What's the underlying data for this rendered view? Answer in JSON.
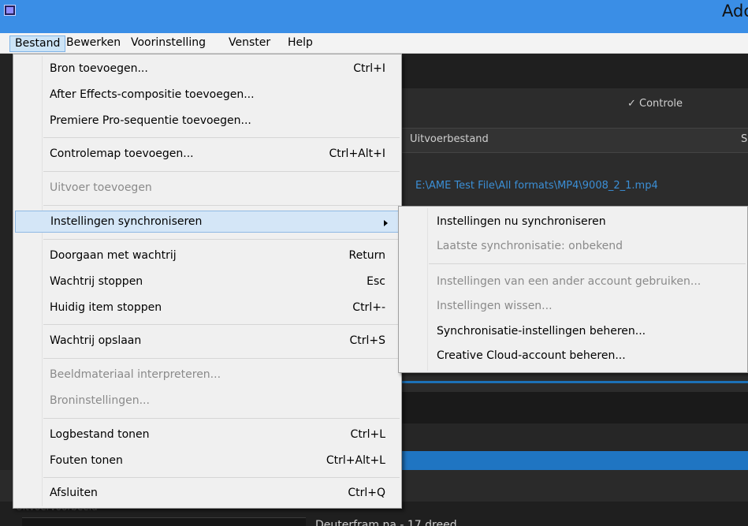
{
  "window": {
    "title": "Adc"
  },
  "menubar": {
    "items": [
      {
        "label": "Bestand"
      },
      {
        "label": "Bewerken"
      },
      {
        "label": "Voorinstelling"
      },
      {
        "label": "Venster"
      },
      {
        "label": "Help"
      }
    ]
  },
  "app": {
    "watch_label": "✓ Controle",
    "column_output": "Uitvoerbestand",
    "column_second": "S",
    "file_path": "E:\\AME Test File\\All formats\\MP4\\9008_2_1.mp4",
    "bottom_label": "Uitvoervoorbeeld",
    "bottom_title": "Deuterfram na - 17 dreed"
  },
  "file_menu": {
    "items": [
      {
        "label": "Bron toevoegen...",
        "shortcut": "Ctrl+I"
      },
      {
        "label": "After Effects-compositie toevoegen...",
        "shortcut": ""
      },
      {
        "label": "Premiere Pro-sequentie toevoegen...",
        "shortcut": ""
      },
      {
        "label": "Controlemap toevoegen...",
        "shortcut": "Ctrl+Alt+I"
      },
      {
        "label": "Uitvoer toevoegen",
        "shortcut": "",
        "disabled": true
      },
      {
        "label": "Instellingen synchroniseren",
        "shortcut": "",
        "submenu": true
      },
      {
        "label": "Doorgaan met wachtrij",
        "shortcut": "Return"
      },
      {
        "label": "Wachtrij stoppen",
        "shortcut": "Esc"
      },
      {
        "label": "Huidig item stoppen",
        "shortcut": "Ctrl+-"
      },
      {
        "label": "Wachtrij opslaan",
        "shortcut": "Ctrl+S"
      },
      {
        "label": "Beeldmateriaal interpreteren...",
        "shortcut": "",
        "disabled": true
      },
      {
        "label": "Broninstellingen...",
        "shortcut": "",
        "disabled": true
      },
      {
        "label": "Logbestand tonen",
        "shortcut": "Ctrl+L"
      },
      {
        "label": "Fouten tonen",
        "shortcut": "Ctrl+Alt+L"
      },
      {
        "label": "Afsluiten",
        "shortcut": "Ctrl+Q"
      }
    ]
  },
  "sync_submenu": {
    "items": [
      {
        "label": "Instellingen nu synchroniseren"
      },
      {
        "label": "Laatste synchronisatie: onbekend",
        "disabled": true
      },
      {
        "label": "Instellingen van een ander account gebruiken...",
        "disabled": true
      },
      {
        "label": "Instellingen wissen...",
        "disabled": true
      },
      {
        "label": "Synchronisatie-instellingen beheren..."
      },
      {
        "label": "Creative Cloud-account beheren..."
      }
    ]
  },
  "colors": {
    "titlebar": "#3a8ee6",
    "menu_highlight": "#cce4f7",
    "file_path": "#3b8fd6",
    "progress": "#1f75c2"
  }
}
